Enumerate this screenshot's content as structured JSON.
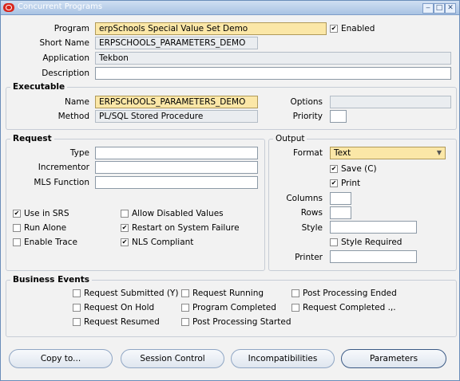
{
  "window": {
    "title": "Concurrent Programs"
  },
  "main": {
    "program_label": "Program",
    "program_value": "erpSchools Special Value Set Demo",
    "enabled_label": "Enabled",
    "enabled_checked": true,
    "short_name_label": "Short Name",
    "short_name_value": "ERPSCHOOLS_PARAMETERS_DEMO",
    "application_label": "Application",
    "application_value": "Tekbon",
    "description_label": "Description",
    "description_value": ""
  },
  "executable": {
    "section_title": "Executable",
    "name_label": "Name",
    "name_value": "ERPSCHOOLS_PARAMETERS_DEMO",
    "method_label": "Method",
    "method_value": "PL/SQL Stored Procedure",
    "options_label": "Options",
    "options_value": "",
    "priority_label": "Priority",
    "priority_value": ""
  },
  "request": {
    "section_title": "Request",
    "type_label": "Type",
    "incrementor_label": "Incrementor",
    "mls_label": "MLS Function",
    "use_in_srs": "Use in SRS",
    "allow_disabled": "Allow Disabled Values",
    "run_alone": "Run Alone",
    "restart": "Restart on System Failure",
    "enable_trace": "Enable Trace",
    "nls": "NLS Compliant",
    "checks": {
      "use_in_srs": true,
      "allow_disabled": false,
      "run_alone": false,
      "restart": true,
      "enable_trace": false,
      "nls": true
    }
  },
  "output": {
    "section_title": "Output",
    "format_label": "Format",
    "format_value": "Text",
    "save_label": "Save (C)",
    "print_label": "Print",
    "columns_label": "Columns",
    "rows_label": "Rows",
    "style_label": "Style",
    "style_required_label": "Style Required",
    "printer_label": "Printer",
    "checks": {
      "save": true,
      "print": true,
      "style_required": false
    }
  },
  "business_events": {
    "section_title": "Business Events",
    "request_submitted": "Request Submitted (Y)",
    "request_running": "Request Running",
    "post_processing_ended": "Post Processing Ended",
    "request_on_hold": "Request On Hold",
    "program_completed": "Program Completed",
    "request_completed": "Request Completed .,.",
    "request_resumed": "Request Resumed",
    "post_processing_started": "Post Processing Started"
  },
  "buttons": {
    "copy": "Copy to...",
    "session": "Session Control",
    "incompat": "Incompatibilities",
    "parameters": "Parameters"
  },
  "check_glyph": "✔"
}
